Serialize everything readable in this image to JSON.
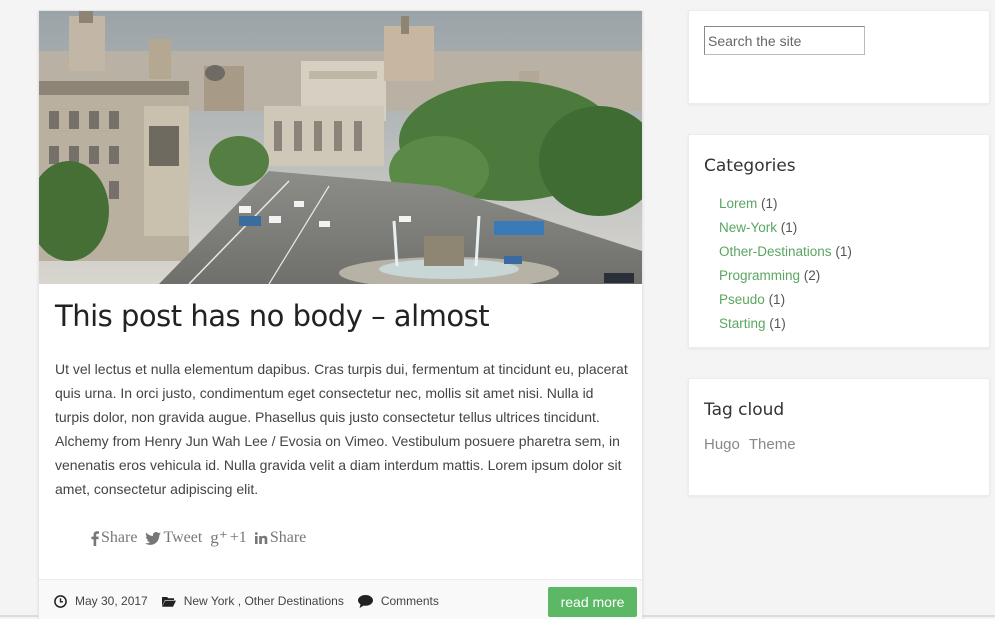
{
  "post": {
    "title": "This post has no body – almost",
    "body": "Ut vel lectus et nulla elementum dapibus. Cras turpis dui, fermentum at tincidunt eu, placerat quis urna. In orci justo, condimentum eget consectetur nec, mollis sit amet nisi. Nulla id turpis dolor, non gravida augue. Phasellus quis justo consectetur tellus ultrices tincidunt. Alchemy from Henry Jun Wah Lee / Evosia on Vimeo. Vestibulum posuere pharetra sem, in venenatis eros vehicula id. Nulla gravida velit a diam interdum mattis. Lorem ipsum dolor sit amet, consectetur adipiscing elit.",
    "share": {
      "facebook_label": "Share",
      "twitter_label": "Tweet",
      "gplus_glyph": "g⁺",
      "gplus_label": "+1",
      "linkedin_label": "Share"
    },
    "meta": {
      "date": "May 30, 2017",
      "category_1": "New York",
      "category_separator": " , ",
      "category_2": "Other Destinations",
      "comments_label": "Comments"
    },
    "read_more_label": "read more"
  },
  "sidebar": {
    "search": {
      "placeholder": "Search the site"
    },
    "categories": {
      "title": "Categories",
      "items": [
        {
          "name": "Lorem",
          "count": "(1)"
        },
        {
          "name": "New-York",
          "count": "(1)"
        },
        {
          "name": "Other-Destinations",
          "count": "(1)"
        },
        {
          "name": "Programming",
          "count": "(2)"
        },
        {
          "name": "Pseudo",
          "count": "(1)"
        },
        {
          "name": "Starting",
          "count": "(1)"
        }
      ]
    },
    "tags": {
      "title": "Tag cloud",
      "items": [
        "Hugo",
        "Theme"
      ]
    }
  },
  "colors": {
    "accent_green": "#5cb865",
    "link_green": "#5aa661",
    "background": "#f4f4f4"
  },
  "icons": {
    "facebook": "facebook-icon",
    "twitter": "twitter-icon",
    "gplus": "google-plus-icon",
    "linkedin": "linkedin-icon",
    "clock": "clock-icon",
    "folder": "folder-icon",
    "comment": "comment-icon"
  }
}
